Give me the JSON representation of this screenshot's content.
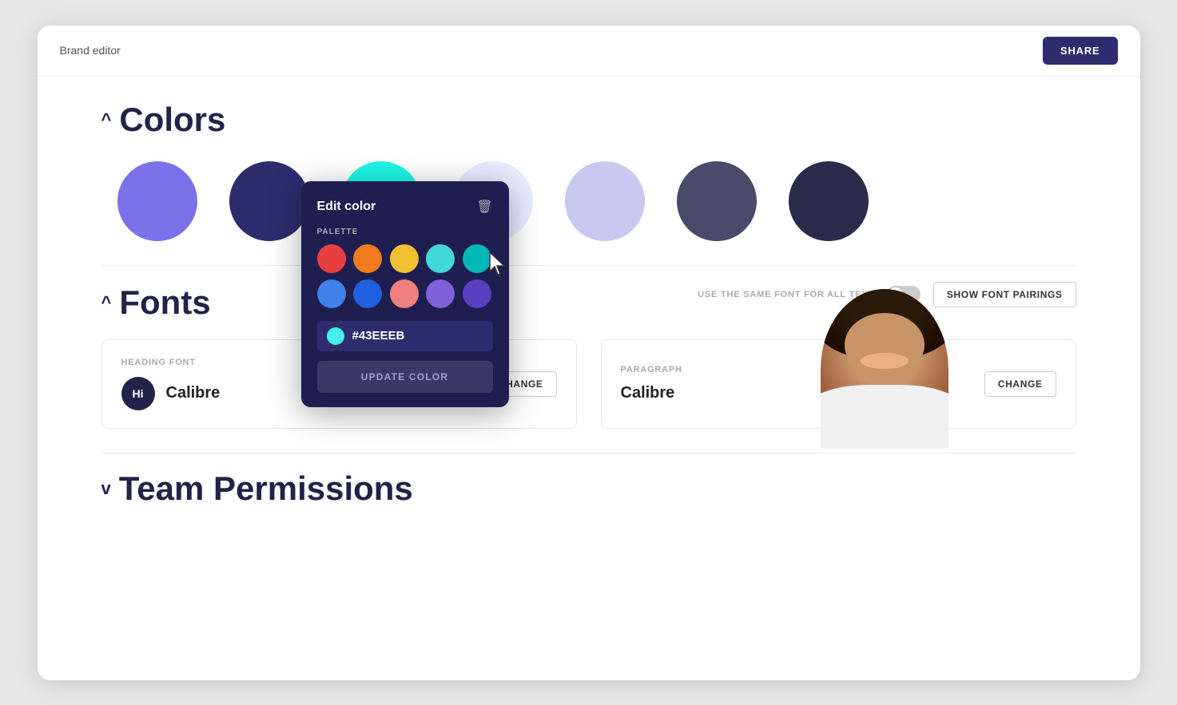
{
  "header": {
    "title": "Brand editor",
    "share_label": "SHARE"
  },
  "colors_section": {
    "title": "Colors",
    "chevron": "^",
    "swatches": [
      {
        "id": "swatch-1",
        "color": "#7b72e9"
      },
      {
        "id": "swatch-2",
        "color": "#2d2d6e"
      },
      {
        "id": "swatch-3",
        "color": "#1ef5e4"
      },
      {
        "id": "swatch-4",
        "color": "#e8ecff"
      },
      {
        "id": "swatch-5",
        "color": "#c8c8f0"
      },
      {
        "id": "swatch-6",
        "color": "#4a4a6a"
      },
      {
        "id": "swatch-7",
        "color": "#2a2a4a"
      }
    ]
  },
  "fonts_section": {
    "title": "Fonts",
    "chevron": "^",
    "same_font_label": "USE THE SAME FONT FOR ALL TEXT",
    "show_pairings_label": "SHOW FONT PAIRINGS",
    "heading_font_label": "HEADING FONT",
    "heading_font_icon": "Hi",
    "heading_font_name": "Calibre",
    "paragraph_label": "PARAGRAPH",
    "paragraph_font_name": "Calibre",
    "change_label_1": "CHANGE",
    "change_label_2": "CHANGE"
  },
  "team_permissions": {
    "title": "Team Permissions",
    "chevron": "v"
  },
  "edit_color_popup": {
    "title": "Edit color",
    "palette_label": "PALETTE",
    "hex_value": "#43EEEB",
    "update_btn_label": "UPDATE COLOR",
    "palette_colors": [
      "#e84040",
      "#f47a20",
      "#f0c030",
      "#40d8d8",
      "#00b8b8",
      "#4080e8",
      "#2060e0",
      "#f08080",
      "#8060d8",
      "#5840c0"
    ]
  }
}
